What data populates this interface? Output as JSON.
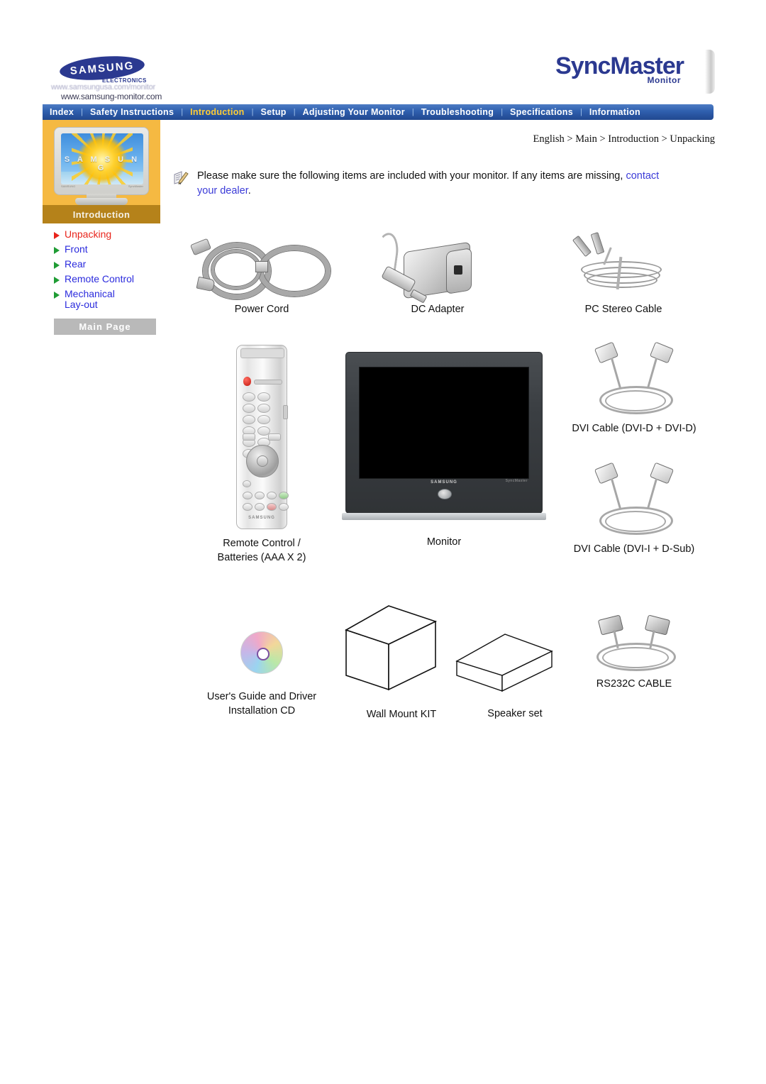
{
  "header": {
    "brand_word": "SAMSUNG",
    "brand_sub": "ELECTRONICS",
    "url_top": "www.samsungusa.com/monitor",
    "url_bottom": "www.samsung-monitor.com",
    "product_logo": "SyncMaster",
    "product_logo_sub": "Monitor",
    "accent_blue": "#2b3990"
  },
  "nav": {
    "items": [
      {
        "label": "Index",
        "active": false
      },
      {
        "label": "Safety Instructions",
        "active": false
      },
      {
        "label": "Introduction",
        "active": true
      },
      {
        "label": "Setup",
        "active": false
      },
      {
        "label": "Adjusting Your Monitor",
        "active": false
      },
      {
        "label": "Troubleshooting",
        "active": false
      },
      {
        "label": "Specifications",
        "active": false
      },
      {
        "label": "Information",
        "active": false
      }
    ],
    "separator": "|",
    "bar_color": "#2f5fae",
    "active_color": "#ffcc33"
  },
  "sidebar": {
    "thumb_label": "Introduction",
    "thumb_screen_text": "S A M S U N G",
    "items": [
      {
        "label": "Unpacking",
        "active": true
      },
      {
        "label": "Front",
        "active": false
      },
      {
        "label": "Rear",
        "active": false
      },
      {
        "label": "Remote Control",
        "active": false
      },
      {
        "label": "Mechanical",
        "label2": "Lay-out",
        "active": false
      }
    ],
    "main_page_label": "Main Page",
    "active_color": "#e8241b",
    "link_color": "#2b2bdd"
  },
  "content": {
    "breadcrumb": "English > Main > Introduction > Unpacking",
    "notice_pre": "Please make sure the following items are included with your monitor. If any items are missing, ",
    "notice_link": "contact your dealer",
    "notice_post": ".",
    "items": [
      {
        "caption": "Power Cord",
        "art": "power-cord"
      },
      {
        "caption": "DC Adapter",
        "art": "dc-adapter"
      },
      {
        "caption": "PC Stereo Cable",
        "art": "pc-stereo-cable"
      },
      {
        "caption": "Remote Control /\nBatteries (AAA X 2)",
        "art": "remote-control"
      },
      {
        "caption": "Monitor",
        "art": "monitor"
      },
      {
        "caption": "DVI Cable (DVI-D + DVI-D)",
        "art": "dvi-cable-dd"
      },
      {
        "caption": "DVI Cable (DVI-I + D-Sub)",
        "art": "dvi-cable-id"
      },
      {
        "caption": "User's Guide and Driver\nInstallation CD",
        "art": "cd"
      },
      {
        "caption": "Wall Mount KIT",
        "art": "wall-mount-box"
      },
      {
        "caption": "Speaker set",
        "art": "speaker-box"
      },
      {
        "caption": "RS232C CABLE",
        "art": "rs232c-cable"
      }
    ],
    "monitor_brand": "SAMSUNG",
    "remote_brand": "SAMSUNG"
  }
}
